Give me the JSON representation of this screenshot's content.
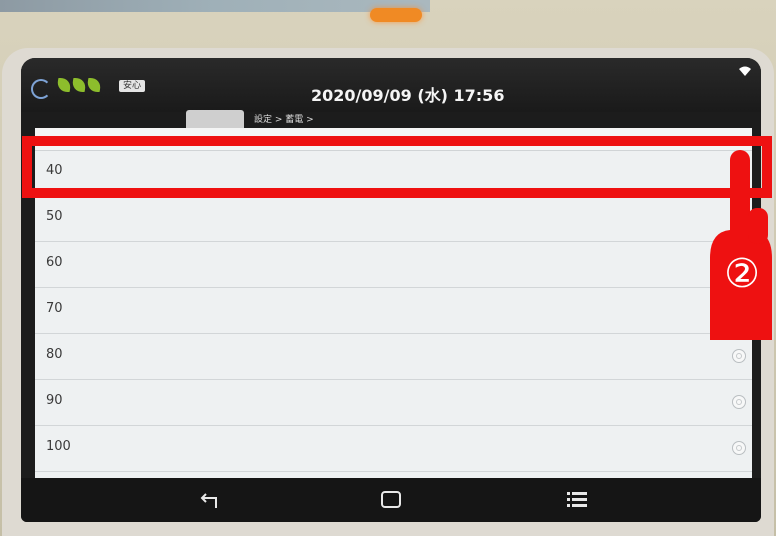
{
  "status_bar": {
    "badge": "安心",
    "datetime": "2020/09/09 (水) 17:56"
  },
  "breadcrumb": "設定 > 蓄電 >",
  "options": [
    {
      "label": "40",
      "selected": true
    },
    {
      "label": "50",
      "selected": false
    },
    {
      "label": "60",
      "selected": false
    },
    {
      "label": "70",
      "selected": false
    },
    {
      "label": "80",
      "selected": false
    },
    {
      "label": "90",
      "selected": false
    },
    {
      "label": "100",
      "selected": false
    }
  ],
  "annotation": {
    "step_number": "②",
    "highlight_color": "#ee1111"
  },
  "nav": {
    "back": "back-icon",
    "home": "home-icon",
    "menu": "menu-icon"
  },
  "colors": {
    "leaf": "#8dbd2c",
    "accent_led": "#f08a24"
  }
}
